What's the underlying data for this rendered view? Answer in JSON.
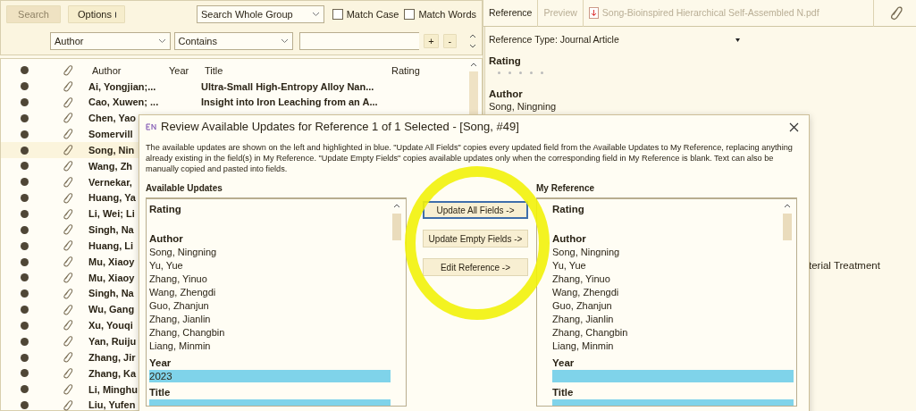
{
  "search_bar": {
    "search_button": {
      "label": "Search",
      "disabled": true
    },
    "options_button": {
      "label": "Options"
    },
    "scope": "Search Whole Group",
    "checkboxes": [
      {
        "label": "Match Case",
        "checked": false
      },
      {
        "label": "Match Words",
        "checked": false
      }
    ],
    "criteria": {
      "field": "Author",
      "operator": "Contains",
      "add": "+",
      "remove": "-"
    }
  },
  "list": {
    "columns": [
      "Author",
      "Year",
      "Title",
      "Rating"
    ],
    "rows": [
      {
        "author": "Ai, Yongjian;...",
        "title": "Ultra-Small High-Entropy Alloy Nan...",
        "selected": false
      },
      {
        "author": "Cao, Xuwen; ...",
        "title": "Insight into Iron Leaching from an A...",
        "selected": false
      },
      {
        "author": "Chen, Yao",
        "selected": false
      },
      {
        "author": "Somervill",
        "selected": false
      },
      {
        "author": "Song, Nin",
        "selected": true
      },
      {
        "author": "Wang, Zh",
        "selected": false
      },
      {
        "author": "Vernekar,",
        "selected": false
      },
      {
        "author": "Huang, Ya",
        "selected": false
      },
      {
        "author": "Li, Wei; Li",
        "selected": false
      },
      {
        "author": "Singh, Na",
        "selected": false
      },
      {
        "author": "Huang, Li",
        "selected": false
      },
      {
        "author": "Mu, Xiaoy",
        "selected": false
      },
      {
        "author": "Mu, Xiaoy",
        "selected": false
      },
      {
        "author": "Singh, Na",
        "selected": false
      },
      {
        "author": "Wu, Gang",
        "selected": false
      },
      {
        "author": "Xu, Youqi",
        "selected": false
      },
      {
        "author": "Yan, Ruiju",
        "selected": false
      },
      {
        "author": "Zhang, Jir",
        "selected": false
      },
      {
        "author": "Zhang, Ka",
        "selected": false
      },
      {
        "author": "Li, Minghu",
        "selected": false
      },
      {
        "author": "Liu, Yufen",
        "selected": false
      }
    ]
  },
  "reference_panel": {
    "tabs": [
      {
        "label": "Reference",
        "selected": true,
        "kind": "text"
      },
      {
        "label": "Preview",
        "selected": false,
        "kind": "text"
      },
      {
        "label": "Song-Bioinspired Hierarchical Self-Assembled N.pdf",
        "selected": false,
        "kind": "pdf"
      }
    ],
    "reference_type": {
      "label": "Reference Type:",
      "value": "Journal Article"
    },
    "rating": {
      "label": "Rating",
      "stars": 0
    },
    "author": {
      "label": "Author",
      "value": "Song, Ningning"
    },
    "text_1": "terial Treatment"
  },
  "dialog": {
    "title": "Review Available Updates for Reference 1 of 1 Selected - [Song,  #49]",
    "description": "The available updates are shown on the left and highlighted in blue. \"Update All Fields\" copies every updated field from the Available Updates to My Reference, replacing anything already existing in the field(s) in My Reference. \"Update Empty Fields\" copies available updates only when the corresponding field in My Reference is blank. Text can also be manually copied and pasted into fields.",
    "panes": [
      {
        "heading": "Available Updates",
        "fields": [
          {
            "label": "Rating",
            "highlighted": false
          },
          {
            "label": "Author",
            "highlighted": false,
            "values": [
              "Song, Ningning",
              "Yu, Yue",
              "Zhang, Yinuo",
              "Wang, Zhengdi",
              "Guo, Zhanjun",
              "Zhang, Jianlin",
              "Zhang, Changbin",
              "Liang, Minmin"
            ]
          },
          {
            "label": "Year",
            "highlighted": true,
            "values": [
              "2023"
            ]
          },
          {
            "label": "Title",
            "highlighted": true
          }
        ]
      },
      {
        "heading": "My Reference",
        "fields": [
          {
            "label": "Rating",
            "highlighted": false
          },
          {
            "label": "Author",
            "highlighted": false,
            "values": [
              "Song, Ningning",
              "Yu, Yue",
              "Zhang, Yinuo",
              "Wang, Zhengdi",
              "Guo, Zhanjun",
              "Zhang, Jianlin",
              "Zhang, Changbin",
              "Liang, Minmin"
            ]
          },
          {
            "label": "Year",
            "highlighted": true
          },
          {
            "label": "Title",
            "highlighted": true
          }
        ]
      }
    ],
    "buttons": [
      {
        "label": "Update All Fields ->",
        "focused": true
      },
      {
        "label": "Update Empty Fields ->",
        "focused": false
      },
      {
        "label": "Edit Reference ->",
        "focused": false
      }
    ]
  }
}
